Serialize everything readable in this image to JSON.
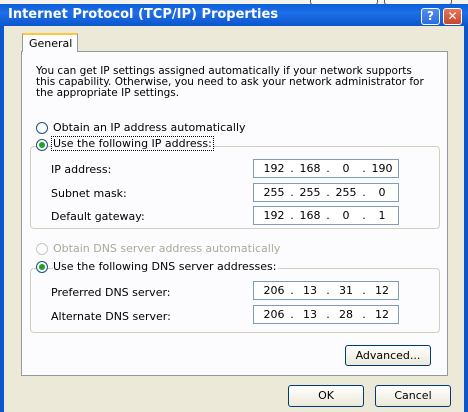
{
  "window": {
    "title": "Internet Protocol (TCP/IP) Properties",
    "help_glyph": "?",
    "close_glyph": "✕"
  },
  "tabs": [
    {
      "label": "General",
      "selected": true
    }
  ],
  "intro_lines": [
    "You can get IP settings assigned automatically if your network supports",
    "this capability. Otherwise, you need to ask your network administrator for",
    "the appropriate IP settings."
  ],
  "ip_mode": {
    "auto_label": "Obtain an IP address automatically",
    "manual_label": "Use the following IP address:",
    "selected": "manual"
  },
  "ip_fields": [
    {
      "label": "IP address:",
      "octets": [
        "192",
        "168",
        "0",
        "190"
      ]
    },
    {
      "label": "Subnet mask:",
      "octets": [
        "255",
        "255",
        "255",
        "0"
      ]
    },
    {
      "label": "Default gateway:",
      "octets": [
        "192",
        "168",
        "0",
        "1"
      ]
    }
  ],
  "dns_mode": {
    "auto_label": "Obtain DNS server address automatically",
    "auto_enabled": false,
    "manual_label": "Use the following DNS server addresses:",
    "selected": "manual"
  },
  "dns_fields": [
    {
      "label": "Preferred DNS server:",
      "octets": [
        "206",
        "13",
        "31",
        "12"
      ]
    },
    {
      "label": "Alternate DNS server:",
      "octets": [
        "206",
        "13",
        "28",
        "12"
      ]
    }
  ],
  "buttons": {
    "advanced": "Advanced...",
    "ok": "OK",
    "cancel": "Cancel"
  }
}
